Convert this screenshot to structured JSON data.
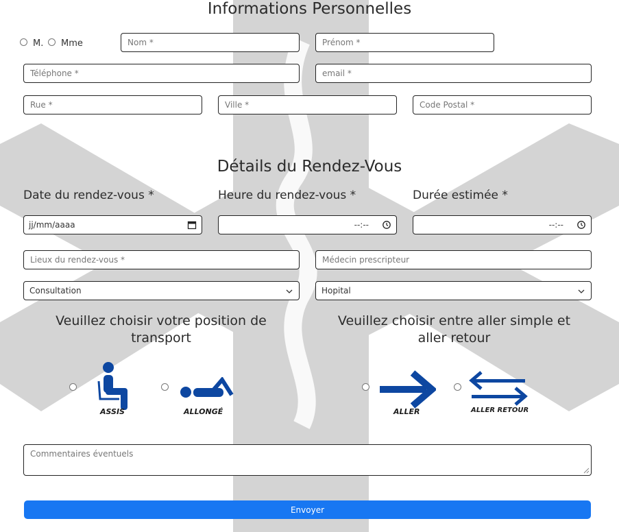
{
  "personal": {
    "title": "Informations Personnelles",
    "civility": [
      "M.",
      "Mme"
    ],
    "nom_placeholder": "Nom *",
    "prenom_placeholder": "Prénom *",
    "telephone_placeholder": "Téléphone *",
    "email_placeholder": "email *",
    "rue_placeholder": "Rue *",
    "ville_placeholder": "Ville *",
    "code_postal_placeholder": "Code Postal *"
  },
  "appointment": {
    "title": "Détails du Rendez-Vous",
    "date_label": "Date du rendez-vous *",
    "heure_label": "Heure du rendez-vous *",
    "duree_label": "Durée estimée *",
    "date_value": "jj/mm/aaaa",
    "heure_value": "--:--",
    "duree_value": "--:--",
    "lieux_placeholder": "Lieux du rendez-vous *",
    "medecin_placeholder": "Médecin prescripteur",
    "type_select": "Consultation",
    "lieu_select": "Hopital"
  },
  "transport": {
    "position_heading": "Veuillez choisir votre position de transport",
    "trip_heading": "Veuillez choisir entre aller simple et aller retour",
    "options": [
      "ASSIS",
      "ALLONGÉ",
      "ALLER",
      "ALLER RETOUR"
    ]
  },
  "comments_placeholder": "Commentaires éventuels",
  "submit_label": "Envoyer",
  "colors": {
    "accent": "#1877f2",
    "icon_blue": "#0d47a1",
    "background_art": "#d4d4d4"
  }
}
